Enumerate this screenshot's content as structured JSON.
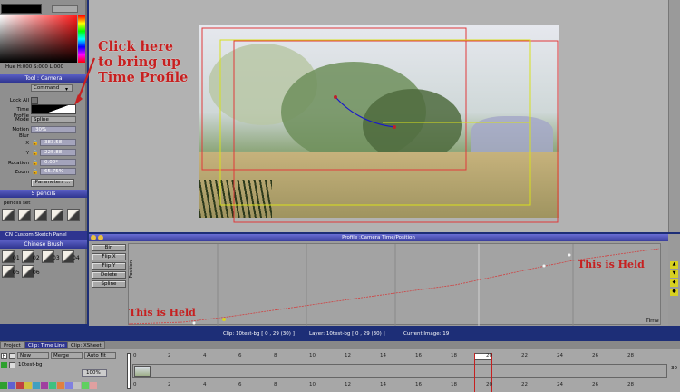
{
  "color_panel": {
    "hsl_readout": "Hue H:000 S:000 L:000"
  },
  "tool_panel": {
    "title": "Tool : Camera",
    "mode_select": "Command",
    "lock_all_label": "Lock All",
    "time_profile_label": "Time Profile",
    "mode_label": "Mode",
    "mode_value": "Spline",
    "motion_blur_label": "Motion Blur",
    "motion_blur_value": "30%",
    "fields": [
      {
        "label": "X",
        "value": "383.58"
      },
      {
        "label": "Y",
        "value": "225.88"
      },
      {
        "label": "Rotation",
        "value": "0.00°"
      },
      {
        "label": "Zoom",
        "value": "65.75%"
      }
    ],
    "parameters_button": "Parameters ..."
  },
  "pencils_panel": {
    "title": "5 pencils",
    "set_label": "pencils set"
  },
  "brush_panel": {
    "sketch_label": "CN Custom Sketch Panel",
    "title": "Chinese Brush",
    "items": [
      "01",
      "02",
      "03",
      "04",
      "05",
      "06"
    ]
  },
  "annotation": {
    "line1": "Click here",
    "line2": "to bring up",
    "line3": "Time Profile",
    "held_right": "This is Held",
    "held_left": "This is Held"
  },
  "profile": {
    "title": "Profile :Camera Time/Position",
    "buttons": [
      "Bin",
      "Flip X",
      "Flip Y",
      "Delete",
      "Spline"
    ],
    "y_axis": "Position",
    "x_axis": "Time"
  },
  "status": {
    "clip": "Clip: 10test-bg [ 0 , 29  (30) ]",
    "layer": "Layer: 10test-bg [ 0 , 29  (30) ]",
    "current_image": "Current Image: 19"
  },
  "tabs": [
    "Project",
    "Clip: Time Line",
    "Clip: XSheet"
  ],
  "timeline": {
    "layer_selects": [
      "New",
      "Merge",
      "Auto Fit"
    ],
    "layer_name": "10test-bg",
    "ticks": [
      "0",
      "2",
      "4",
      "6",
      "8",
      "10",
      "12",
      "14",
      "16",
      "18",
      "20",
      "22",
      "24",
      "26",
      "28"
    ],
    "end_frame": "30",
    "opacity_value": "100%"
  },
  "colors": {
    "accent": "#1d2e77",
    "annotation": "#c62020",
    "frame_red": "#e0393a",
    "frame_yellow": "#d8e01c"
  }
}
